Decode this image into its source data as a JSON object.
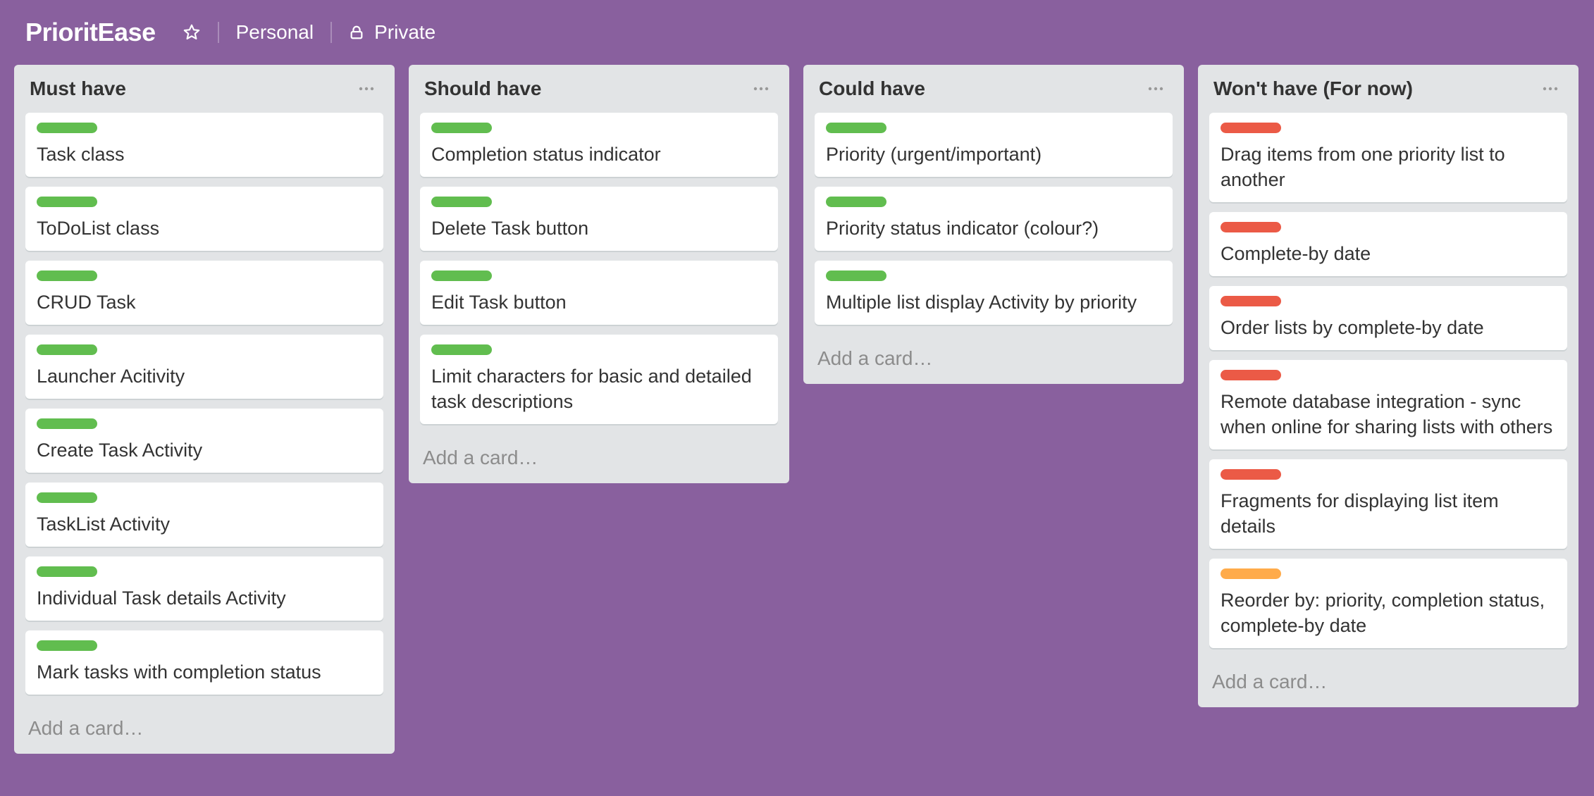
{
  "header": {
    "title": "PrioritEase",
    "team_label": "Personal",
    "visibility_label": "Private"
  },
  "colors": {
    "background": "#89609e",
    "label_green": "#61bd4f",
    "label_red": "#eb5a46",
    "label_orange": "#ffab4a"
  },
  "lists": [
    {
      "title": "Must have",
      "add_card": "Add a card…",
      "cards": [
        {
          "label": "green",
          "text": "Task class"
        },
        {
          "label": "green",
          "text": "ToDoList class"
        },
        {
          "label": "green",
          "text": "CRUD Task"
        },
        {
          "label": "green",
          "text": "Launcher Acitivity"
        },
        {
          "label": "green",
          "text": "Create Task Activity"
        },
        {
          "label": "green",
          "text": "TaskList Activity"
        },
        {
          "label": "green",
          "text": "Individual Task details Activity"
        },
        {
          "label": "green",
          "text": "Mark tasks with completion status"
        }
      ]
    },
    {
      "title": "Should have",
      "add_card": "Add a card…",
      "cards": [
        {
          "label": "green",
          "text": "Completion status indicator"
        },
        {
          "label": "green",
          "text": "Delete Task button"
        },
        {
          "label": "green",
          "text": "Edit Task button"
        },
        {
          "label": "green",
          "text": "Limit characters for basic and detailed task descriptions"
        }
      ]
    },
    {
      "title": "Could have",
      "add_card": "Add a card…",
      "cards": [
        {
          "label": "green",
          "text": "Priority (urgent/important)"
        },
        {
          "label": "green",
          "text": "Priority status indicator (colour?)"
        },
        {
          "label": "green",
          "text": "Multiple list display Activity by priority"
        }
      ]
    },
    {
      "title": "Won't have (For now)",
      "add_card": "Add a card…",
      "cards": [
        {
          "label": "red",
          "text": "Drag items from one priority list to another"
        },
        {
          "label": "red",
          "text": "Complete-by date"
        },
        {
          "label": "red",
          "text": "Order lists by complete-by date"
        },
        {
          "label": "red",
          "text": "Remote database integration - sync when online for sharing lists with others"
        },
        {
          "label": "red",
          "text": "Fragments for displaying list item details"
        },
        {
          "label": "orange",
          "text": "Reorder by: priority, completion status, complete-by date"
        }
      ]
    }
  ]
}
